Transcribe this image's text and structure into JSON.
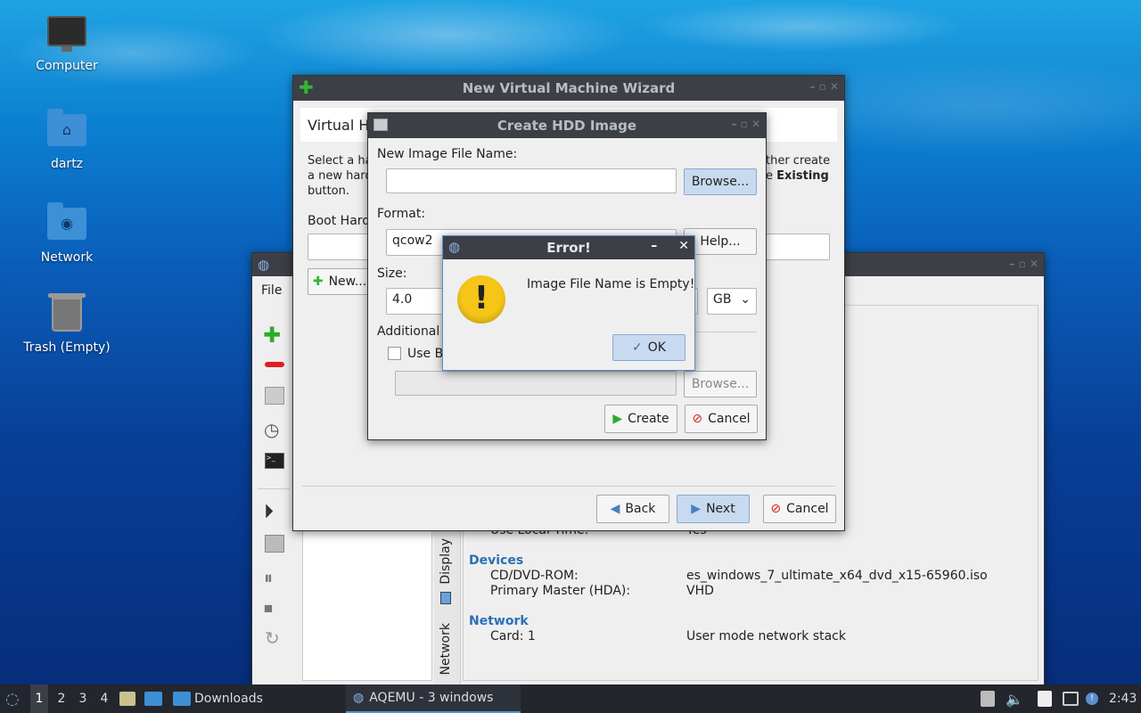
{
  "desktop": {
    "icons": [
      {
        "label": "Computer"
      },
      {
        "label": "dartz"
      },
      {
        "label": "Network"
      },
      {
        "label": "Trash (Empty)"
      }
    ]
  },
  "aqemu": {
    "menu_file": "File",
    "tabs": [
      "Display",
      "Network"
    ],
    "details": {
      "use_local_time_label": "Use Local Time:",
      "use_local_time_value": "Yes",
      "devices_heading": "Devices",
      "cdrom_label": "CD/DVD-ROM:",
      "cdrom_value": "es_windows_7_ultimate_x64_dvd_x15-65960.iso",
      "hda_label": "Primary Master (HDA):",
      "hda_value": "VHD",
      "network_heading": "Network",
      "card_label": "Card: 1",
      "card_value": "User mode network stack"
    }
  },
  "wizard": {
    "title": "New Virtual Machine Wizard",
    "header": "Virtual Ha",
    "desc_left_1": "Select a har",
    "desc_left_2": "a new hard",
    "desc_left_3": "button.",
    "desc_right_1": "ther create",
    "desc_right_2": "e",
    "desc_right_bold": "Existing",
    "boot_label": "Boot Hard",
    "new_button": "New...",
    "back_button": "Back",
    "next_button": "Next",
    "cancel_button": "Cancel"
  },
  "hdd": {
    "title": "Create HDD Image",
    "filename_label": "New Image File Name:",
    "filename_value": "",
    "browse_button": "Browse...",
    "format_label": "Format:",
    "format_value": "qcow2",
    "help_button": "Help...",
    "size_label": "Size:",
    "size_value": "4.0",
    "size_unit": "GB",
    "additional_label": "Additional",
    "use_backing_label": "Use B",
    "browse2_button": "Browse...",
    "create_button": "Create",
    "cancel_button": "Cancel"
  },
  "error": {
    "title": "Error!",
    "message": "Image File Name is Empty!",
    "ok_button": "OK"
  },
  "taskbar": {
    "workspaces": [
      "1",
      "2",
      "3",
      "4"
    ],
    "downloads": "Downloads",
    "aqemu_task": "AQEMU - 3 windows",
    "clock": "2:43"
  },
  "colors": {
    "accent_heading": "#2a6fb5",
    "titlebar": "#3c3f46",
    "taskbar": "#23262c",
    "warning_yellow": "#f5c518"
  }
}
